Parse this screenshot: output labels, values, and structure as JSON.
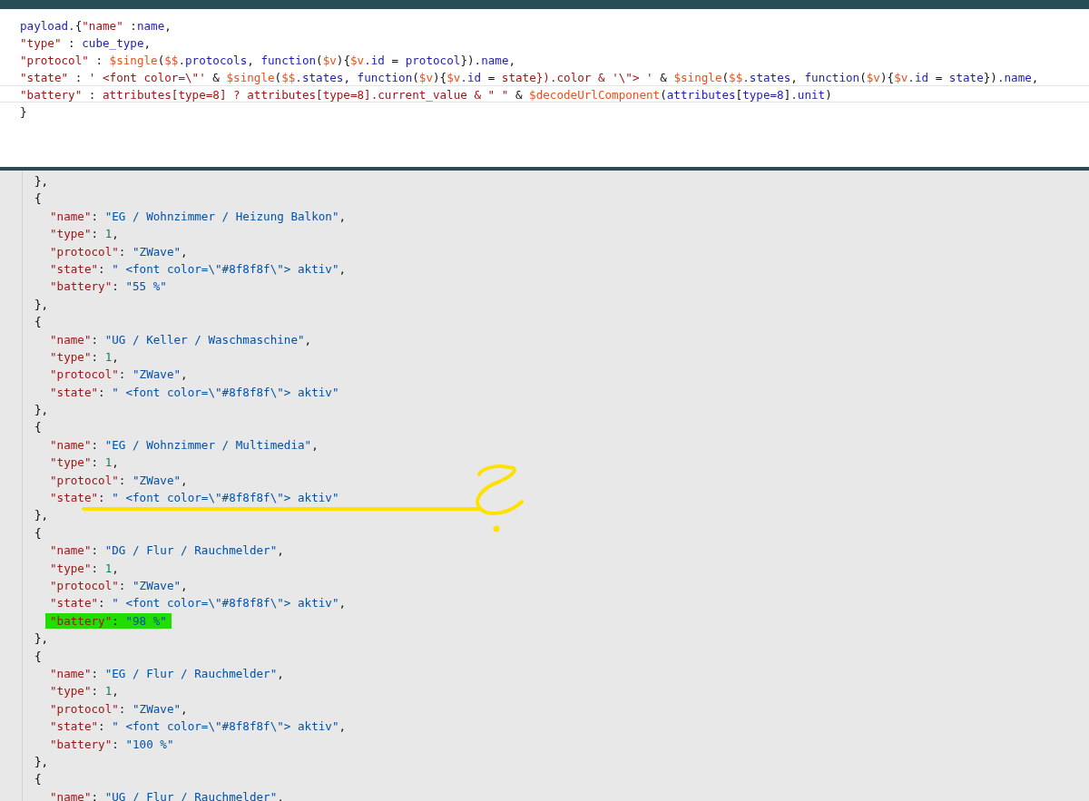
{
  "editor": {
    "lines": [
      [
        {
          "kind": "ident",
          "text": "payload."
        },
        {
          "kind": "punct",
          "text": "{"
        },
        {
          "kind": "string",
          "text": "\"name\""
        },
        {
          "kind": "punct",
          "text": " :"
        },
        {
          "kind": "ident",
          "text": "name"
        },
        {
          "kind": "punct",
          "text": ","
        }
      ],
      [
        {
          "kind": "string",
          "text": "\"type\""
        },
        {
          "kind": "punct",
          "text": " : "
        },
        {
          "kind": "ident",
          "text": "cube_type"
        },
        {
          "kind": "punct",
          "text": ","
        }
      ],
      [
        {
          "kind": "string",
          "text": "\"protocol\""
        },
        {
          "kind": "punct",
          "text": " : "
        },
        {
          "kind": "func",
          "text": "$single"
        },
        {
          "kind": "punct",
          "text": "("
        },
        {
          "kind": "func",
          "text": "$$"
        },
        {
          "kind": "ident",
          "text": ".protocols"
        },
        {
          "kind": "punct",
          "text": ", "
        },
        {
          "kind": "ident",
          "text": "function"
        },
        {
          "kind": "punct",
          "text": "("
        },
        {
          "kind": "func",
          "text": "$v"
        },
        {
          "kind": "punct",
          "text": "){"
        },
        {
          "kind": "func",
          "text": "$v"
        },
        {
          "kind": "ident",
          "text": ".id"
        },
        {
          "kind": "punct",
          "text": " = "
        },
        {
          "kind": "ident",
          "text": "protocol"
        },
        {
          "kind": "punct",
          "text": "})"
        },
        {
          "kind": "ident",
          "text": ".name"
        },
        {
          "kind": "punct",
          "text": ","
        }
      ],
      [
        {
          "kind": "string",
          "text": "\"state\""
        },
        {
          "kind": "punct",
          "text": " : "
        },
        {
          "kind": "string",
          "text": "' <font color=\\\"'"
        },
        {
          "kind": "punct",
          "text": " & "
        },
        {
          "kind": "func",
          "text": "$single"
        },
        {
          "kind": "punct",
          "text": "("
        },
        {
          "kind": "func",
          "text": "$$"
        },
        {
          "kind": "ident",
          "text": ".states"
        },
        {
          "kind": "punct",
          "text": ", "
        },
        {
          "kind": "ident",
          "text": "function"
        },
        {
          "kind": "punct",
          "text": "("
        },
        {
          "kind": "func",
          "text": "$v"
        },
        {
          "kind": "punct",
          "text": "){"
        },
        {
          "kind": "func",
          "text": "$v"
        },
        {
          "kind": "ident",
          "text": ".id"
        },
        {
          "kind": "punct",
          "text": " = "
        },
        {
          "kind": "string",
          "text": "state}).color & '\\\"> '"
        },
        {
          "kind": "punct",
          "text": " & "
        },
        {
          "kind": "func",
          "text": "$single"
        },
        {
          "kind": "punct",
          "text": "("
        },
        {
          "kind": "func",
          "text": "$$"
        },
        {
          "kind": "ident",
          "text": ".states"
        },
        {
          "kind": "punct",
          "text": ", "
        },
        {
          "kind": "ident",
          "text": "function"
        },
        {
          "kind": "punct",
          "text": "("
        },
        {
          "kind": "func",
          "text": "$v"
        },
        {
          "kind": "punct",
          "text": "){"
        },
        {
          "kind": "func",
          "text": "$v"
        },
        {
          "kind": "ident",
          "text": ".id"
        },
        {
          "kind": "punct",
          "text": " = "
        },
        {
          "kind": "ident",
          "text": "state"
        },
        {
          "kind": "punct",
          "text": "})"
        },
        {
          "kind": "ident",
          "text": ".name"
        },
        {
          "kind": "punct",
          "text": ","
        }
      ],
      [
        {
          "kind": "string",
          "text": "\"battery\""
        },
        {
          "kind": "punct",
          "text": " : "
        },
        {
          "kind": "string",
          "text": "attributes[type=8] ? attributes[type=8].current_value & \" \""
        },
        {
          "kind": "punct",
          "text": " & "
        },
        {
          "kind": "func",
          "text": "$decodeUrlComponent"
        },
        {
          "kind": "punct",
          "text": "("
        },
        {
          "kind": "ident",
          "text": "attributes"
        },
        {
          "kind": "punct",
          "text": "["
        },
        {
          "kind": "ident",
          "text": "type=8"
        },
        {
          "kind": "punct",
          "text": "]"
        },
        {
          "kind": "ident",
          "text": ".unit"
        },
        {
          "kind": "punct",
          "text": ")"
        }
      ],
      [
        {
          "kind": "punct",
          "text": "}"
        }
      ]
    ],
    "line_current": [
      false,
      false,
      false,
      false,
      true,
      false
    ]
  },
  "output": {
    "records": [
      {
        "close": "},"
      },
      {
        "open": "{",
        "close": "},",
        "fields": [
          {
            "key": "\"name\"",
            "colon": ": ",
            "value": "\"EG / Wohnzimmer / Heizung Balkon\"",
            "kind": "string",
            "comma": ",",
            "highlighted": false
          },
          {
            "key": "\"type\"",
            "colon": ": ",
            "value": "1",
            "kind": "number",
            "comma": ",",
            "highlighted": false
          },
          {
            "key": "\"protocol\"",
            "colon": ": ",
            "value": "\"ZWave\"",
            "kind": "string",
            "comma": ",",
            "highlighted": false
          },
          {
            "key": "\"state\"",
            "colon": ": ",
            "value": "\" <font color=\\\"#8f8f8f\\\"> aktiv\"",
            "kind": "string",
            "comma": ",",
            "highlighted": false
          },
          {
            "key": "\"battery\"",
            "colon": ": ",
            "value": "\"55 %\"",
            "kind": "string",
            "highlighted": false
          }
        ]
      },
      {
        "open": "{",
        "close": "},",
        "fields": [
          {
            "key": "\"name\"",
            "colon": ": ",
            "value": "\"UG / Keller / Waschmaschine\"",
            "kind": "string",
            "comma": ",",
            "highlighted": false
          },
          {
            "key": "\"type\"",
            "colon": ": ",
            "value": "1",
            "kind": "number",
            "comma": ",",
            "highlighted": false
          },
          {
            "key": "\"protocol\"",
            "colon": ": ",
            "value": "\"ZWave\"",
            "kind": "string",
            "comma": ",",
            "highlighted": false
          },
          {
            "key": "\"state\"",
            "colon": ": ",
            "value": "\" <font color=\\\"#8f8f8f\\\"> aktiv\"",
            "kind": "string",
            "highlighted": false
          }
        ]
      },
      {
        "open": "{",
        "close": "},",
        "fields": [
          {
            "key": "\"name\"",
            "colon": ": ",
            "value": "\"EG / Wohnzimmer / Multimedia\"",
            "kind": "string",
            "comma": ",",
            "highlighted": false
          },
          {
            "key": "\"type\"",
            "colon": ": ",
            "value": "1",
            "kind": "number",
            "comma": ",",
            "highlighted": false
          },
          {
            "key": "\"protocol\"",
            "colon": ": ",
            "value": "\"ZWave\"",
            "kind": "string",
            "comma": ",",
            "highlighted": false
          },
          {
            "key": "\"state\"",
            "colon": ": ",
            "value": "\" <font color=\\\"#8f8f8f\\\"> aktiv\"",
            "kind": "string",
            "highlighted": false
          }
        ]
      },
      {
        "open": "{",
        "close": "},",
        "fields": [
          {
            "key": "\"name\"",
            "colon": ": ",
            "value": "\"DG / Flur / Rauchmelder\"",
            "kind": "string",
            "comma": ",",
            "highlighted": false
          },
          {
            "key": "\"type\"",
            "colon": ": ",
            "value": "1",
            "kind": "number",
            "comma": ",",
            "highlighted": false
          },
          {
            "key": "\"protocol\"",
            "colon": ": ",
            "value": "\"ZWave\"",
            "kind": "string",
            "comma": ",",
            "highlighted": false
          },
          {
            "key": "\"state\"",
            "colon": ": ",
            "value": "\" <font color=\\\"#8f8f8f\\\"> aktiv\"",
            "kind": "string",
            "comma": ",",
            "highlighted": false
          },
          {
            "key": "\"battery\"",
            "colon": ": ",
            "value": "\"98 %\"",
            "kind": "string",
            "highlighted": true
          }
        ]
      },
      {
        "open": "{",
        "close": "},",
        "fields": [
          {
            "key": "\"name\"",
            "colon": ": ",
            "value": "\"EG / Flur / Rauchmelder\"",
            "kind": "string",
            "comma": ",",
            "highlighted": false
          },
          {
            "key": "\"type\"",
            "colon": ": ",
            "value": "1",
            "kind": "number",
            "comma": ",",
            "highlighted": false
          },
          {
            "key": "\"protocol\"",
            "colon": ": ",
            "value": "\"ZWave\"",
            "kind": "string",
            "comma": ",",
            "highlighted": false
          },
          {
            "key": "\"state\"",
            "colon": ": ",
            "value": "\" <font color=\\\"#8f8f8f\\\"> aktiv\"",
            "kind": "string",
            "comma": ",",
            "highlighted": false
          },
          {
            "key": "\"battery\"",
            "colon": ": ",
            "value": "\"100 %\"",
            "kind": "string",
            "highlighted": false
          }
        ]
      },
      {
        "open": "{",
        "fields": [
          {
            "key": "\"name\"",
            "colon": ": ",
            "value": "\"UG / Flur / Rauchmelder\"",
            "kind": "string",
            "comma": ",",
            "highlighted": false
          }
        ]
      }
    ]
  }
}
